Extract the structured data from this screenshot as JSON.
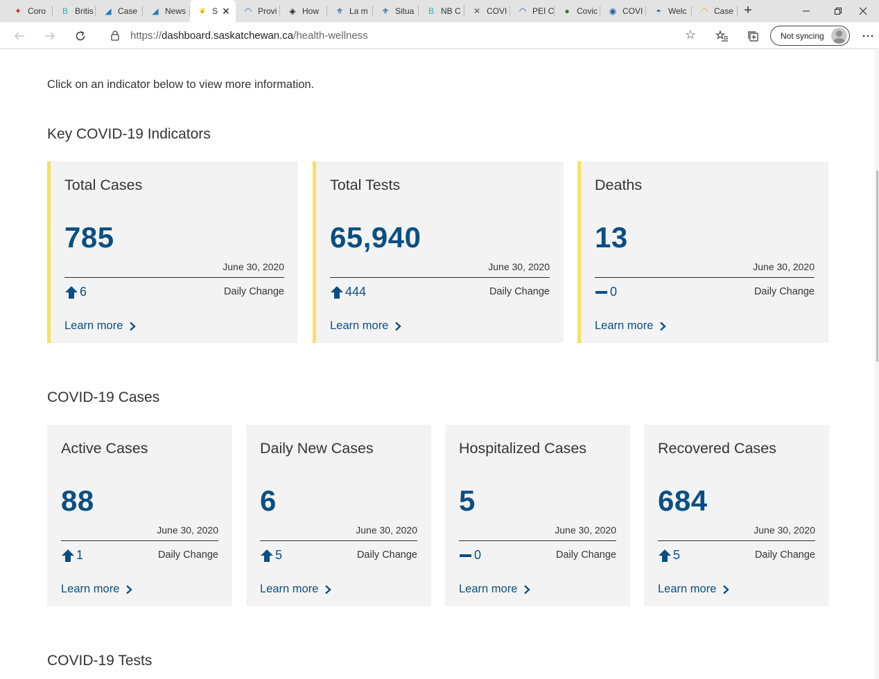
{
  "browser": {
    "tabs": [
      {
        "label": "Coro",
        "icon": "maple-leaf-icon",
        "color": "#d52b1e"
      },
      {
        "label": "Britis",
        "icon": "bc-logo-icon",
        "color": "#2ab3b1"
      },
      {
        "label": "Case",
        "icon": "chart-doc-icon",
        "color": "#1a7fc1"
      },
      {
        "label": "News",
        "icon": "chart-doc-icon",
        "color": "#1a7fc1"
      },
      {
        "label": "S",
        "icon": "saskatchewan-icon",
        "color": "#e8b400",
        "active": true
      },
      {
        "label": "Provi",
        "icon": "arc-icon",
        "color": "#1a5fa8"
      },
      {
        "label": "How",
        "icon": "shield-icon",
        "color": "#222222"
      },
      {
        "label": "La m",
        "icon": "quebec-icon",
        "color": "#095797"
      },
      {
        "label": "Situa",
        "icon": "quebec-icon",
        "color": "#095797"
      },
      {
        "label": "NB C",
        "icon": "bc-logo-icon",
        "color": "#2ab3b1"
      },
      {
        "label": "COVI",
        "icon": "ns-flag-icon",
        "color": "#555555"
      },
      {
        "label": "PEI C",
        "icon": "arc-icon",
        "color": "#1a5fa8"
      },
      {
        "label": "Covic",
        "icon": "globe-icon",
        "color": "#2e7d32"
      },
      {
        "label": "COVI",
        "icon": "nl-logo-icon",
        "color": "#1a5fa8"
      },
      {
        "label": "Welc",
        "icon": "yukon-icon",
        "color": "#1a5fa8"
      },
      {
        "label": "Case",
        "icon": "sun-icon",
        "color": "#f2a900"
      }
    ],
    "url_scheme": "https://",
    "url_host": "dashboard.saskatchewan.ca",
    "url_path": "/health-wellness",
    "sync_label": "Not syncing"
  },
  "page": {
    "intro": "Click on an indicator below to view more information.",
    "sections": {
      "key_title": "Key COVID-19 Indicators",
      "cases_title": "COVID-19 Cases",
      "tests_title": "COVID-19 Tests"
    },
    "key_cards": [
      {
        "title": "Total Cases",
        "value": "785",
        "date": "June 30, 2020",
        "trend": "up",
        "change": "6",
        "change_label": "Daily Change",
        "link": "Learn more"
      },
      {
        "title": "Total Tests",
        "value": "65,940",
        "date": "June 30, 2020",
        "trend": "up",
        "change": "444",
        "change_label": "Daily Change",
        "link": "Learn more"
      },
      {
        "title": "Deaths",
        "value": "13",
        "date": "June 30, 2020",
        "trend": "flat",
        "change": "0",
        "change_label": "Daily Change",
        "link": "Learn more"
      }
    ],
    "case_cards": [
      {
        "title": "Active Cases",
        "value": "88",
        "date": "June 30, 2020",
        "trend": "up",
        "change": "1",
        "change_label": "Daily Change",
        "link": "Learn more"
      },
      {
        "title": "Daily New Cases",
        "value": "6",
        "date": "June 30, 2020",
        "trend": "up",
        "change": "5",
        "change_label": "Daily Change",
        "link": "Learn more"
      },
      {
        "title": "Hospitalized Cases",
        "value": "5",
        "date": "June 30, 2020",
        "trend": "flat",
        "change": "0",
        "change_label": "Daily Change",
        "link": "Learn more"
      },
      {
        "title": "Recovered Cases",
        "value": "684",
        "date": "June 30, 2020",
        "trend": "up",
        "change": "5",
        "change_label": "Daily Change",
        "link": "Learn more"
      }
    ],
    "colors": {
      "accent_blue": "#0a4f83",
      "key_border": "#f9e15e",
      "card_bg": "#f3f3f3"
    }
  }
}
